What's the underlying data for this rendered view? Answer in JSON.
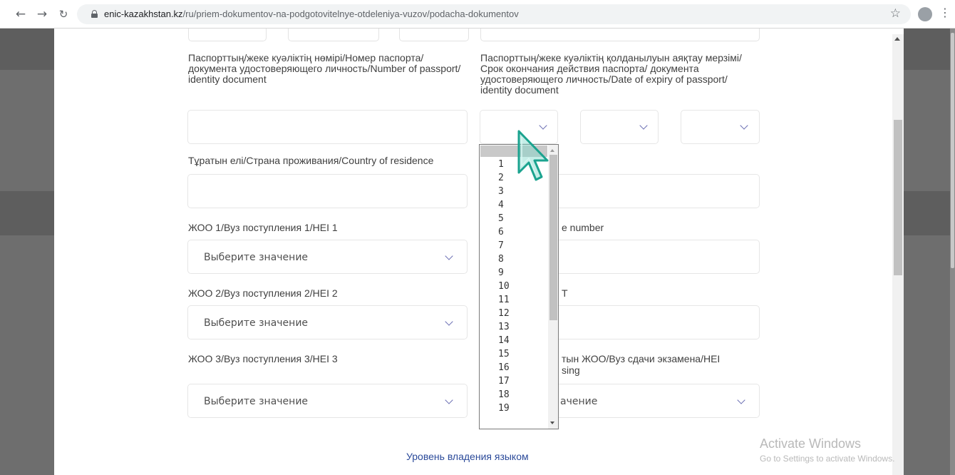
{
  "browser": {
    "url_host": "enic-kazakhstan.kz",
    "url_path": "/ru/priem-dokumentov-na-podgotovitelnye-otdeleniya-vuzov/podacha-dokumentov",
    "back_icon": "arrow-left-icon",
    "forward_icon": "arrow-right-icon",
    "reload_icon": "reload-icon",
    "bookmark_icon": "star-icon",
    "menu_icon": "kebab-icon"
  },
  "form": {
    "passport_number_label": "Паспорттың/жеке куәліктің нөмірі/Номер паспорта/ документа удостоверяющего личность/Number of passport/ identity document",
    "passport_expiry_label": "Паспорттың/жеке куәліктің қолданылуын аяқтау мерзімі/Срок окончания действия паспорта/ документа удостоверяющего личность/Date of expiry of passport/ identity document",
    "country_label": "Тұратын елі/Страна проживания/Country of residence",
    "hei1_label": "ЖОО 1/Вуз поступления 1/HEI 1",
    "hei2_label": "ЖОО 2/Вуз поступления 2/HEI 2",
    "hei3_label": "ЖОО 3/Вуз поступления 3/HEI 3",
    "phone_label_fragment": "e number",
    "right_fragment_2": "T",
    "exam_hei_label_fragment_1": "тын ЖОО/Вуз сдачи экзамена/HEI",
    "exam_hei_label_fragment_2": "sing",
    "select_placeholder": "Выберите значение",
    "exam_select_fragment": "ачение",
    "language_section_title": "Уровень владения языком"
  },
  "day_dropdown": {
    "options": [
      "1",
      "2",
      "3",
      "4",
      "5",
      "6",
      "7",
      "8",
      "9",
      "10",
      "11",
      "12",
      "13",
      "14",
      "15",
      "16",
      "17",
      "18",
      "19"
    ]
  },
  "watermark": {
    "line1": "Activate Windows",
    "line2": "Go to Settings to activate Windows."
  },
  "colors": {
    "accent_blue": "#2b4a9a",
    "chevron": "#6b6fb3",
    "cursor_fill": "#7fd6c9",
    "cursor_outline": "#1ba38f"
  }
}
